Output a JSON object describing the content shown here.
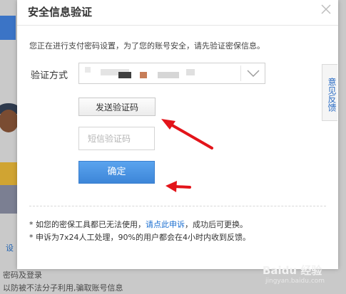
{
  "background": {
    "link_text": "设",
    "line1": "密码及登录",
    "line2": "以防被不法分子利用,骗取账号信息"
  },
  "dialog": {
    "title": "安全信息验证",
    "notice": "您正在进行支付密码设置，为了您的账号安全，请先验证密保信息。",
    "method_label": "验证方式",
    "send_button": "发送验证码",
    "sms_placeholder": "短信验证码",
    "confirm_button": "确定",
    "footer": {
      "line1_prefix": "* 如您的密保工具都已无法使用，",
      "line1_link": "请点此申诉",
      "line1_suffix": "，成功后可更换。",
      "line2": "* 申诉为7x24人工处理，90%的用户都会在4小时内收到反馈。"
    }
  },
  "feedback_tab": "意见反馈",
  "watermark": {
    "brand": "Baidu 经验",
    "url": "jingyan.baidu.com"
  },
  "colors": {
    "accent_blue": "#3d86d8",
    "link_blue": "#1b6fd1",
    "annotation_red": "#e3141a"
  },
  "icons": {
    "close": "close-icon",
    "dropdown": "chevron-down-icon"
  }
}
